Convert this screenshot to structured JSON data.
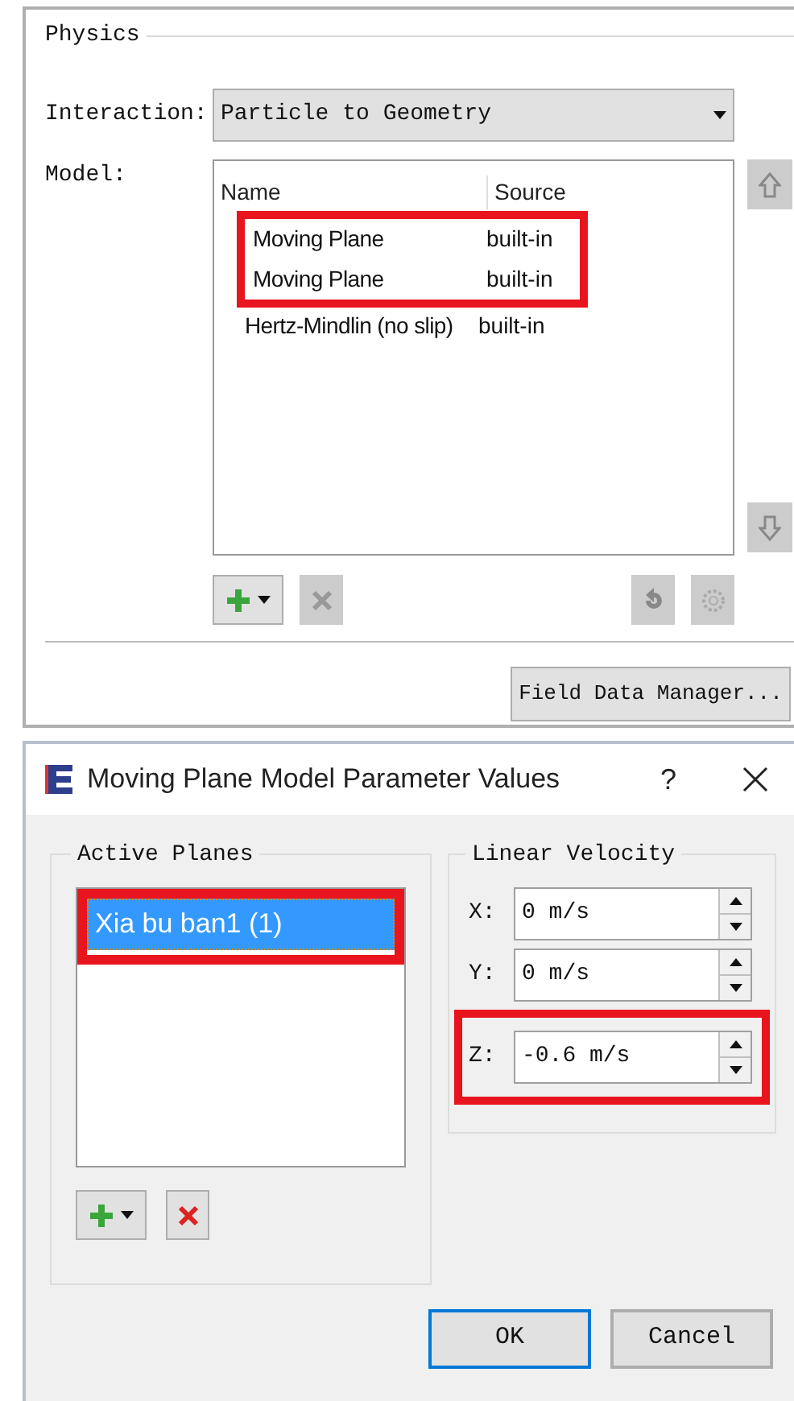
{
  "physics": {
    "title": "Physics",
    "interaction": {
      "label": "Interaction:",
      "value": "Particle to Geometry"
    },
    "model": {
      "label": "Model:",
      "columns": [
        "Name",
        "Source"
      ],
      "rows": [
        {
          "name": "Moving Plane",
          "source": "built-in",
          "highlighted": true
        },
        {
          "name": "Moving Plane",
          "source": "built-in",
          "highlighted": true
        },
        {
          "name": "Hertz-Mindlin (no slip)",
          "source": "built-in",
          "highlighted": false
        }
      ]
    },
    "field_data_button": "Field Data Manager..."
  },
  "dialog": {
    "title": "Moving Plane Model Parameter Values",
    "help": "?",
    "active_planes": {
      "title": "Active Planes",
      "items": [
        {
          "label": "Xia bu ban1 (1)",
          "selected": true,
          "highlighted": true
        }
      ]
    },
    "linear_velocity": {
      "title": "Linear Velocity",
      "fields": [
        {
          "label": "X:",
          "value": "0 m/s",
          "highlighted": false
        },
        {
          "label": "Y:",
          "value": "0 m/s",
          "highlighted": false
        },
        {
          "label": "Z:",
          "value": "-0.6 m/s",
          "highlighted": true
        }
      ]
    },
    "buttons": [
      {
        "label": "OK",
        "selected": true
      },
      {
        "label": "Cancel",
        "selected": false
      }
    ]
  }
}
